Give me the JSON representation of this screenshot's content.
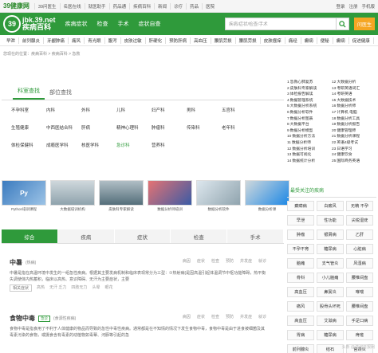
{
  "topbar": {
    "logo": "39健康网",
    "nav": [
      "39问医生",
      "名医在线",
      "就医助手",
      "药品通",
      "疾病百科",
      "新闻",
      "诊疗",
      "药品",
      "医院"
    ],
    "right": [
      "登录",
      "注册",
      "手机版"
    ]
  },
  "header": {
    "brand_en": "jbk.39.net",
    "brand_cn": "疾病百科",
    "nav": [
      "疾病症状",
      "检查",
      "手术",
      "症状自查"
    ],
    "search_placeholder": "疾病/症状/检查/手术",
    "ask_label": "问医生"
  },
  "quickbar": [
    "早泄",
    "前列腺炎",
    "牙龈肿痛",
    "痛风",
    "青光眼",
    "腹泻",
    "皮肤过敏",
    "肝硬化",
    "预防肝病",
    "高血压",
    "腰肌劳损",
    "腰肌劳损",
    "皮肤瘙痒",
    "痛经",
    "癫痫",
    "便秘",
    "癫痫",
    "促进健康"
  ],
  "breadcrumb": "您现在的位置：疾病百科 > 疾病百科 > 急救",
  "dept_tabs": [
    "科室查找",
    "部位查找"
  ],
  "departments": [
    [
      "不孕科室",
      "内科",
      "外科",
      "儿科",
      "妇产科",
      "男科",
      "五官科",
      "皮肤性病"
    ],
    [
      "生殖健康",
      "中西医结合科",
      "肝病",
      "精神心理科",
      "肿瘤科",
      "传染科",
      "老年科"
    ],
    [
      "体检保健科",
      "成瘾医学科",
      "核医学科",
      "急诊科",
      "营养科"
    ]
  ],
  "highlight_dept": "急诊科",
  "ranking": [
    [
      "1",
      "急救心肺复苏",
      "12",
      "大数据分析"
    ],
    [
      "2",
      "皮肤科专家解读",
      "13",
      "考研英语词汇"
    ],
    [
      "3",
      "体检报告解读",
      "14",
      "考研英语"
    ],
    [
      "4",
      "数据管理系统",
      "15",
      "大数据技术"
    ],
    [
      "5",
      "大数据分析系统",
      "16",
      "数据分析师"
    ],
    [
      "6",
      "数据分析软件",
      "17",
      "计算机 电脑"
    ],
    [
      "7",
      "数据分析图表",
      "18",
      "数据分析工具"
    ],
    [
      "8",
      "大数据平台",
      "19",
      "数据分析报告"
    ],
    [
      "9",
      "数据分析模型",
      "20",
      "健康管理师"
    ],
    [
      "10",
      "数据分析方法",
      "21",
      "数据分析课程"
    ],
    [
      "11",
      "数据分析师",
      "22",
      "英语4级考试"
    ],
    [
      "12",
      "数据分析培训",
      "23",
      "日语学习"
    ],
    [
      "13",
      "数据可视化",
      "24",
      "健康饮食"
    ],
    [
      "14",
      "数据统计分析",
      "25",
      "国际商务英语"
    ]
  ],
  "thumbs": [
    "Python培训课程",
    "大数据培训机构",
    "皮肤科专家解读",
    "数据分析师培训",
    "数据分析软件",
    "数据分析课"
  ],
  "sidebar_title": "最受关注的疾病",
  "popular_diseases": [
    [
      "癫痫病",
      "白癜风",
      "无精 不孕"
    ],
    [
      "早泄",
      "性功能",
      "尖锐湿疣"
    ],
    [
      "肿瘤",
      "银屑病",
      "乙肝"
    ],
    [
      "不孕不育",
      "糖尿病",
      "心脏病"
    ],
    [
      "脑瘫",
      "支气管炎",
      "风湿病"
    ],
    [
      "骨科",
      "小儿脑瘫",
      "腰椎间盘"
    ],
    [
      "高血压",
      "鼻窦炎",
      "哮喘"
    ],
    [
      "痛风",
      "股骨头坏死",
      "腰椎间盘"
    ],
    [
      "高血压",
      "艾滋病",
      "手足口病"
    ],
    [
      "胃病",
      "糖尿病",
      "痔疮"
    ],
    [
      "前列腺炎",
      "结石",
      "宫颈炎"
    ],
    [
      "前列腺",
      "阴道炎",
      "肺结核"
    ]
  ],
  "result_tabs": [
    "综合",
    "疾病",
    "症状",
    "检查",
    "手术"
  ],
  "entries": [
    {
      "name": "中暑",
      "alias": "(热病)",
      "badge": "",
      "links": [
        "病因",
        "症状",
        "检查",
        "预防",
        "并发症",
        "就诊"
      ],
      "desc": "中暑是指在高温环境中发生的一组急性疾病。根据其主要发病机制和临床表现常分为三型：①热射病(是因高温引起体温调节中枢功能障碍，热平衡失调使体内热蓄积，临床以高热、意识障碍、无汗为主要症状，主要",
      "tags_label": "相关症状",
      "tags": [
        "高热",
        "无汗 乏力",
        "四肢无力",
        "头晕",
        "眼花"
      ]
    },
    {
      "name": "食物中毒",
      "alias": "(食源性疾病)",
      "badge": "急诊",
      "links": [
        "病因",
        "症状",
        "检查",
        "预防",
        "并发症",
        "就诊"
      ],
      "desc": "食物中毒是指食用了不利于人体健康的物品而导致的急性中毒性疾病。通常都是在不知情的情况下发生食物中毒，食物中毒是由于进食被细菌及其毒素污染的食物，或摄食含有毒素的动植物如毒蕈、河豚等引起的急",
      "tags_label": "",
      "tags": []
    }
  ],
  "watermark": "头条 @洪河日报网"
}
